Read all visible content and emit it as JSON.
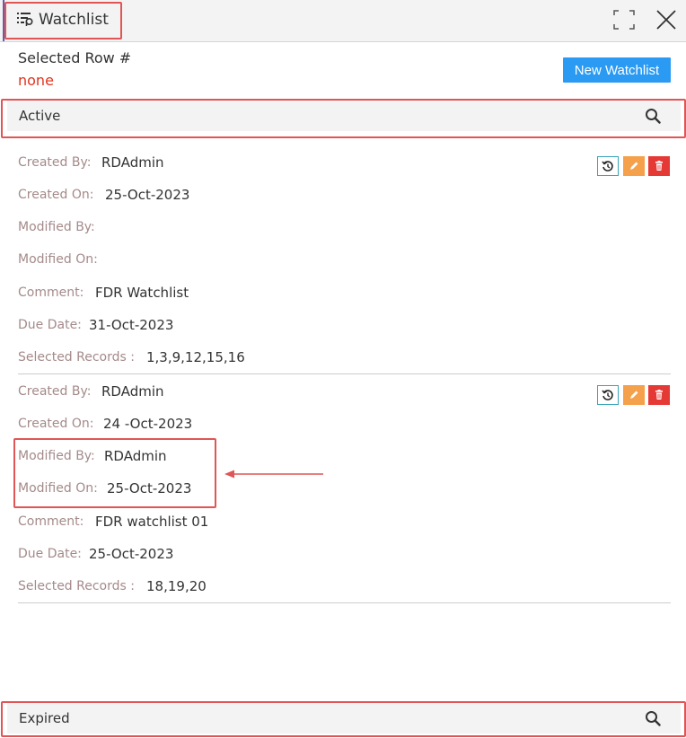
{
  "header": {
    "title": "Watchlist",
    "title_icon": "list-filter-icon",
    "expand_icon": "expand-icon",
    "close_icon": "close-icon"
  },
  "selection": {
    "label": "Selected Row #",
    "value": "none"
  },
  "actions": {
    "new_watchlist_label": "New Watchlist"
  },
  "sections": {
    "active_label": "Active",
    "expired_label": "Expired"
  },
  "field_labels": {
    "created_by": "Created By:",
    "created_on": "Created On:",
    "modified_by": "Modified By:",
    "modified_on": "Modified On:",
    "comment": "Comment:",
    "due_date": "Due Date:",
    "selected_records": "Selected Records :"
  },
  "records": [
    {
      "created_by": "RDAdmin",
      "created_on": "25-Oct-2023",
      "modified_by": "",
      "modified_on": "",
      "comment": "FDR Watchlist",
      "due_date": "31-Oct-2023",
      "selected_records": "1,3,9,12,15,16"
    },
    {
      "created_by": "RDAdmin",
      "created_on": "24 -Oct-2023",
      "modified_by": "RDAdmin",
      "modified_on": "25-Oct-2023",
      "comment": "FDR watchlist 01",
      "due_date": "25-Oct-2023",
      "selected_records": "18,19,20"
    }
  ],
  "colors": {
    "accent_blue": "#2b9af3",
    "annotation_red": "#e05555",
    "label_muted": "#a58a8a",
    "edit_orange": "#f5a04a",
    "delete_red": "#e53935"
  }
}
